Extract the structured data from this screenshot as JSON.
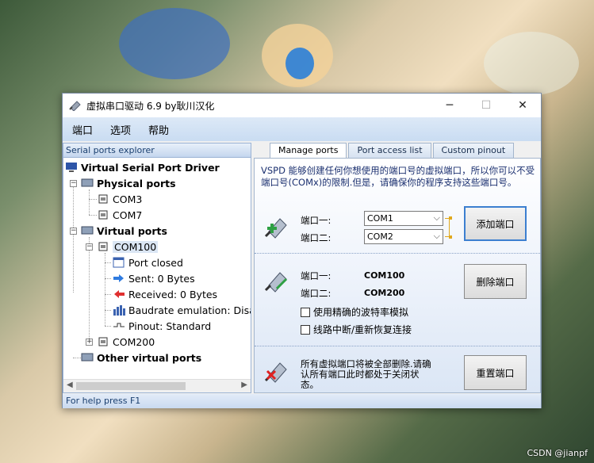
{
  "window": {
    "title": "虚拟串口驱动 6.9 by耿川汉化",
    "minimize": "─",
    "maximize": "☐",
    "close": "✕"
  },
  "menu": [
    "端口",
    "选项",
    "帮助"
  ],
  "explorer": {
    "header": "Serial ports explorer",
    "root": "Virtual Serial Port Driver",
    "physical": "Physical ports",
    "com3": "COM3",
    "com7": "COM7",
    "virtual": "Virtual ports",
    "com100": "COM100",
    "port_closed": "Port closed",
    "sent": "Sent: 0 Bytes",
    "received": "Received: 0 Bytes",
    "baudrate": "Baudrate emulation: Disabl",
    "pinout": "Pinout: Standard",
    "com200": "COM200",
    "other": "Other virtual ports"
  },
  "tabs": [
    "Manage ports",
    "Port access list",
    "Custom pinout"
  ],
  "manage": {
    "description": "VSPD 能够创建任何你想使用的端口号的虚拟端口，所以你可以不受端口号(COMx)的限制.但是，请确保你的程序支持这些端口号。",
    "add": {
      "port1_label": "端口一:",
      "port2_label": "端口二:",
      "port1_value": "COM1",
      "port2_value": "COM2",
      "button": "添加端口"
    },
    "delete": {
      "port1_label": "端口一:",
      "port2_label": "端口二:",
      "port1_value": "COM100",
      "port2_value": "COM200",
      "button": "删除端口",
      "opt1": "使用精确的波特率模拟",
      "opt2": "线路中断/重新恢复连接"
    },
    "reset": {
      "text": "所有虚拟端口将被全部删除.请确认所有端口此时都处于关闭状态。",
      "button": "重置端口"
    }
  },
  "statusbar": "For help press F1",
  "watermark": "CSDN @jianpf",
  "colors": {
    "accent": "#3c7fd0",
    "menubar": "#c9dcf2",
    "bracket": "#e0a81d"
  }
}
